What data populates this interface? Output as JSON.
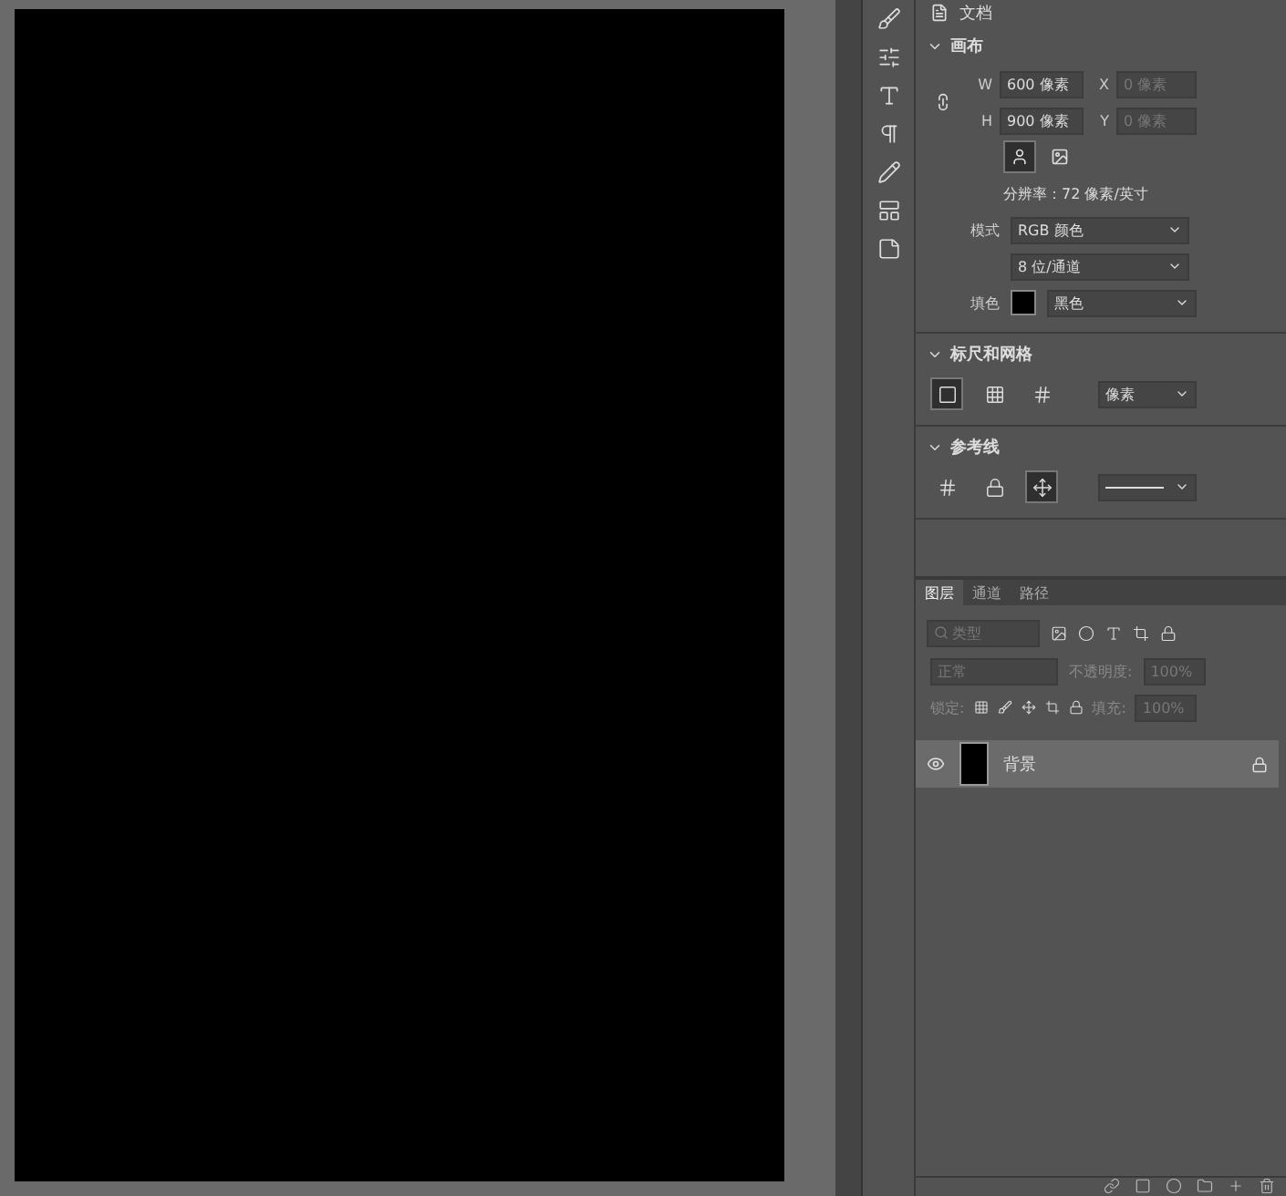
{
  "document_header": {
    "label": "文档"
  },
  "canvas_section": {
    "title": "画布",
    "expanded": true,
    "width_label": "W",
    "width_value": "600 像素",
    "height_label": "H",
    "height_value": "900 像素",
    "x_label": "X",
    "x_placeholder": "0 像素",
    "y_label": "Y",
    "y_placeholder": "0 像素",
    "orientation": [
      {
        "kind": "portrait",
        "selected": true
      },
      {
        "kind": "landscape",
        "selected": false
      }
    ],
    "resolution": "分辨率：72 像素/英寸",
    "mode_label": "模式",
    "mode": "RGB 颜色",
    "depth": "8 位/通道",
    "fill_label": "填色",
    "fill": "黑色"
  },
  "rulers_section": {
    "title": "标尺和网格",
    "expanded": true,
    "tools": [
      {
        "kind": "ruler",
        "selected": true
      },
      {
        "kind": "grid",
        "selected": false
      },
      {
        "kind": "pixel-grid",
        "selected": false
      }
    ],
    "unit": "像素"
  },
  "guides_section": {
    "title": "参考线",
    "expanded": true,
    "tools": [
      {
        "kind": "guides",
        "selected": false
      },
      {
        "kind": "lock",
        "selected": false
      },
      {
        "kind": "smart",
        "selected": true
      }
    ]
  },
  "layers_panel": {
    "tabs": [
      {
        "label": "图层",
        "selected": true
      },
      {
        "label": "通道",
        "selected": false
      },
      {
        "label": "路径",
        "selected": false
      }
    ],
    "filter_placeholder": "类型",
    "blend_mode": "正常",
    "opacity_label": "不透明度:",
    "opacity": "100%",
    "lock_label": "锁定:",
    "fill_label": "填充:",
    "fill": "100%",
    "layers": [
      {
        "name": "背景",
        "visible": true,
        "locked": true,
        "selected": true
      }
    ]
  }
}
